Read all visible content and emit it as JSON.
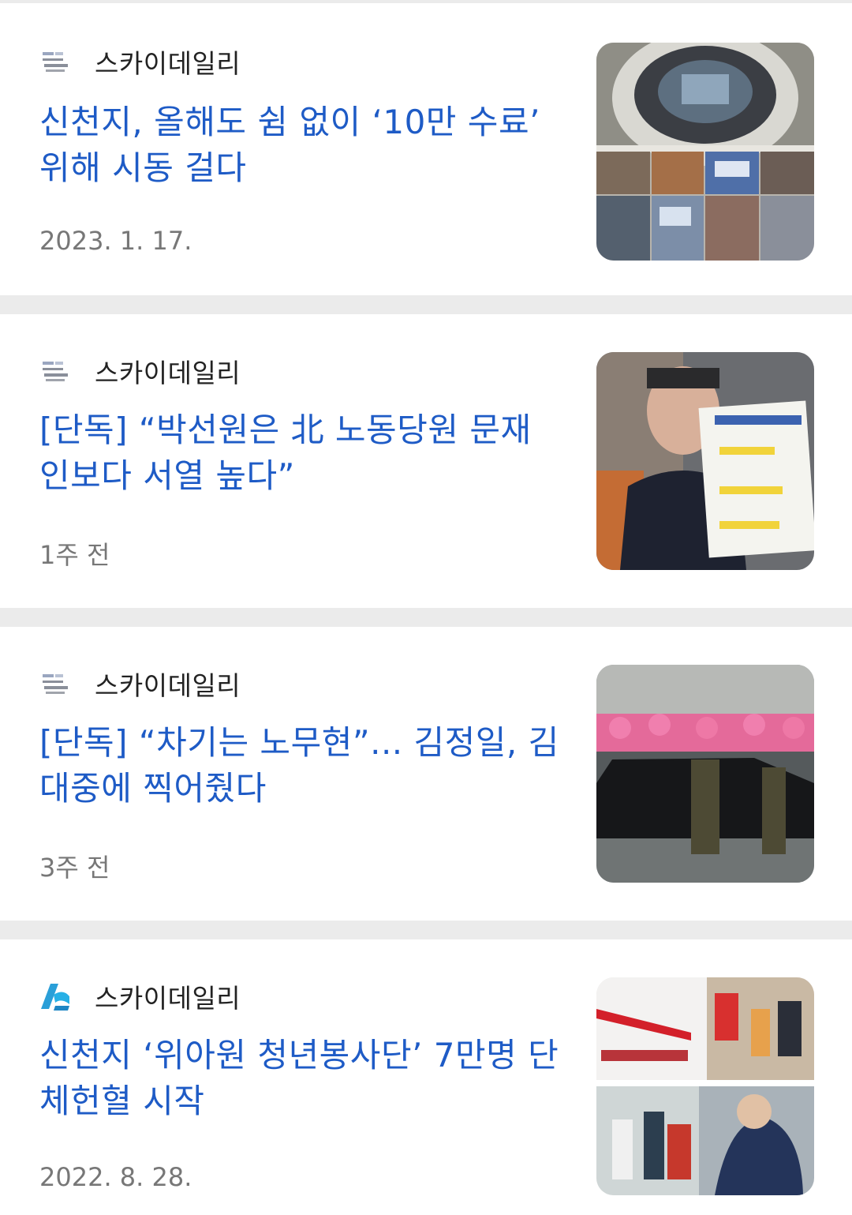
{
  "articles": [
    {
      "source": "스카이데일리",
      "logo_icon": "sky-daily-logo-icon",
      "title": "신천지, 올해도 쉼 없이 ‘10만 수료’ 위해 시동 걸다",
      "date": "2023. 1. 17.",
      "thumbnail": "stadium-collage-image"
    },
    {
      "source": "스카이데일리",
      "logo_icon": "sky-daily-logo-icon",
      "title": "[단독] “박선원은 北 노동당원 문재인보다 서열 높다”",
      "date": "1주 전",
      "thumbnail": "politician-holding-sign-image"
    },
    {
      "source": "스카이데일리",
      "logo_icon": "sky-daily-logo-icon",
      "title": "[단독] “차기는 노무현”... 김정일, 김대중에 찍어줬다",
      "date": "3주 전",
      "thumbnail": "motorcade-soldiers-image"
    },
    {
      "source": "스카이데일리",
      "logo_icon": "sky-daily-blue-logo-icon",
      "title": "신천지 ‘위아원 청년봉사단’ 7만명 단체헌혈 시작",
      "date": "2022. 8. 28.",
      "thumbnail": "blood-donation-collage-image"
    }
  ],
  "colors": {
    "title": "#1e5bc6",
    "source": "#222222",
    "meta": "#777777",
    "separator": "#ebebeb",
    "card": "#ffffff"
  }
}
